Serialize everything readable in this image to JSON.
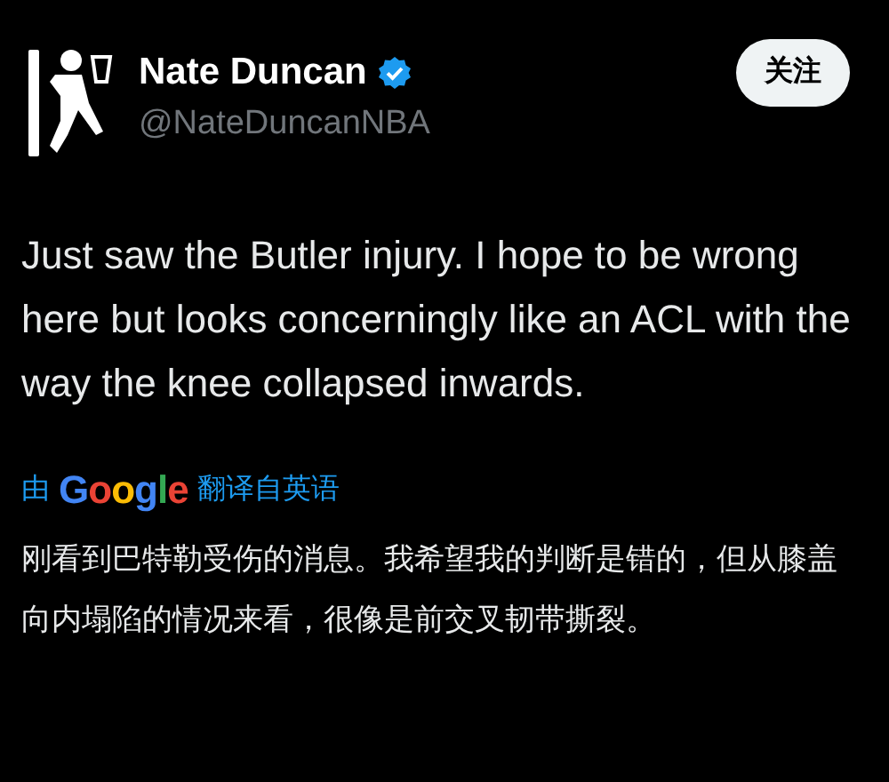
{
  "author": {
    "name": "Nate Duncan",
    "verified": true,
    "handle": "@NateDuncanNBA"
  },
  "follow_button": {
    "label": "关注"
  },
  "tweet": {
    "text": "Just saw the Butler injury. I hope to be wrong here but looks concerningly like an ACL with the way the knee collapsed inwards."
  },
  "translation": {
    "prefix": "由",
    "provider": "Google",
    "suffix": "翻译自英语",
    "text": "刚看到巴特勒受伤的消息。我希望我的判断是错的，但从膝盖向内塌陷的情况来看，很像是前交叉韧带撕裂。"
  }
}
